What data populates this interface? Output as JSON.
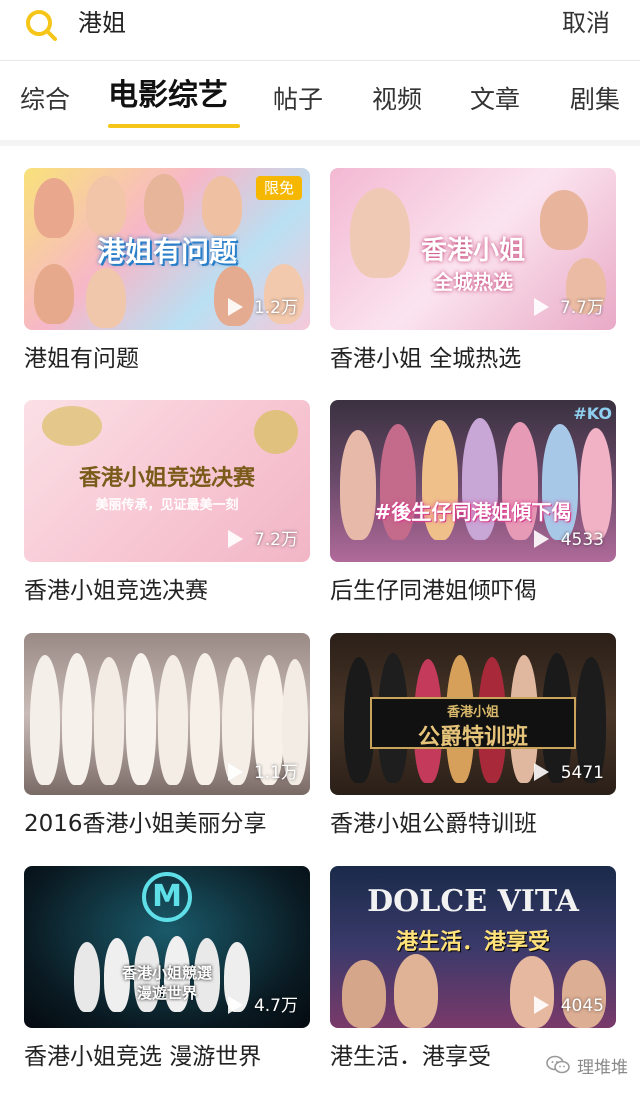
{
  "search": {
    "query": "港姐",
    "cancel_label": "取消",
    "icon": "search-icon"
  },
  "tabs": [
    {
      "label": "综合",
      "active": false
    },
    {
      "label": "电影综艺",
      "active": true
    },
    {
      "label": "帖子",
      "active": false
    },
    {
      "label": "视频",
      "active": false
    },
    {
      "label": "文章",
      "active": false
    },
    {
      "label": "剧集",
      "active": false
    }
  ],
  "accent_color": "#f5c518",
  "results": [
    {
      "title": "港姐有问题",
      "views": "1.2万",
      "badge": "限免",
      "thumb_text": "港姐有问题"
    },
    {
      "title": "香港小姐 全城热选",
      "views": "7.7万",
      "thumb_text": "香港小姐",
      "thumb_subtext": "全城热选"
    },
    {
      "title": "香港小姐竞选决赛",
      "views": "7.2万",
      "thumb_text": "香港小姐竞选决赛",
      "thumb_subtext": "美丽传承，见证最美一刻"
    },
    {
      "title": "后生仔同港姐倾吓偈",
      "views": "4533",
      "thumb_text": "#後生仔同港姐傾下偈",
      "thumb_corner": "#KO"
    },
    {
      "title": "2016香港小姐美丽分享",
      "views": "1.1万"
    },
    {
      "title": "香港小姐公爵特训班",
      "views": "5471",
      "thumb_text": "公爵特训班",
      "thumb_subtext": "香港小姐"
    },
    {
      "title": "香港小姐竞选 漫游世界",
      "views": "4.7万",
      "thumb_text": "香港小姐競選",
      "thumb_subtext": "漫遊世界",
      "thumb_logo": "M"
    },
    {
      "title": "港生活．港享受",
      "views": "4045",
      "thumb_text": "DOLCE VITA",
      "thumb_subtext": "港生活．港享受"
    }
  ],
  "watermark": {
    "text": "理堆堆"
  }
}
